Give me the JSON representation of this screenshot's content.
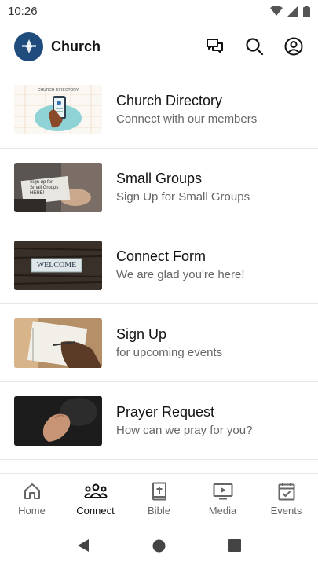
{
  "status_bar": {
    "time": "10:26"
  },
  "app_bar": {
    "title": "Church",
    "icons": [
      "logo-icon",
      "chat-icon",
      "search-icon",
      "account-icon"
    ]
  },
  "items": [
    {
      "title": "Church Directory",
      "subtitle": "Connect with our members",
      "thumb_text": "CHURCH DIRECTORY"
    },
    {
      "title": "Small Groups",
      "subtitle": "Sign Up for Small Groups",
      "thumb_text": "Sign up for Small Groups HERE!"
    },
    {
      "title": "Connect Form",
      "subtitle": "We are glad you're here!",
      "thumb_text": "WELCOME"
    },
    {
      "title": "Sign Up",
      "subtitle": "for upcoming events"
    },
    {
      "title": "Prayer Request",
      "subtitle": "How can we pray for you?"
    }
  ],
  "nav": [
    {
      "label": "Home",
      "icon": "home-icon"
    },
    {
      "label": "Connect",
      "icon": "people-icon",
      "active": true
    },
    {
      "label": "Bible",
      "icon": "bible-icon"
    },
    {
      "label": "Media",
      "icon": "media-icon"
    },
    {
      "label": "Events",
      "icon": "calendar-icon"
    }
  ],
  "system_nav": [
    "back-icon",
    "home-circle-icon",
    "recents-icon"
  ]
}
